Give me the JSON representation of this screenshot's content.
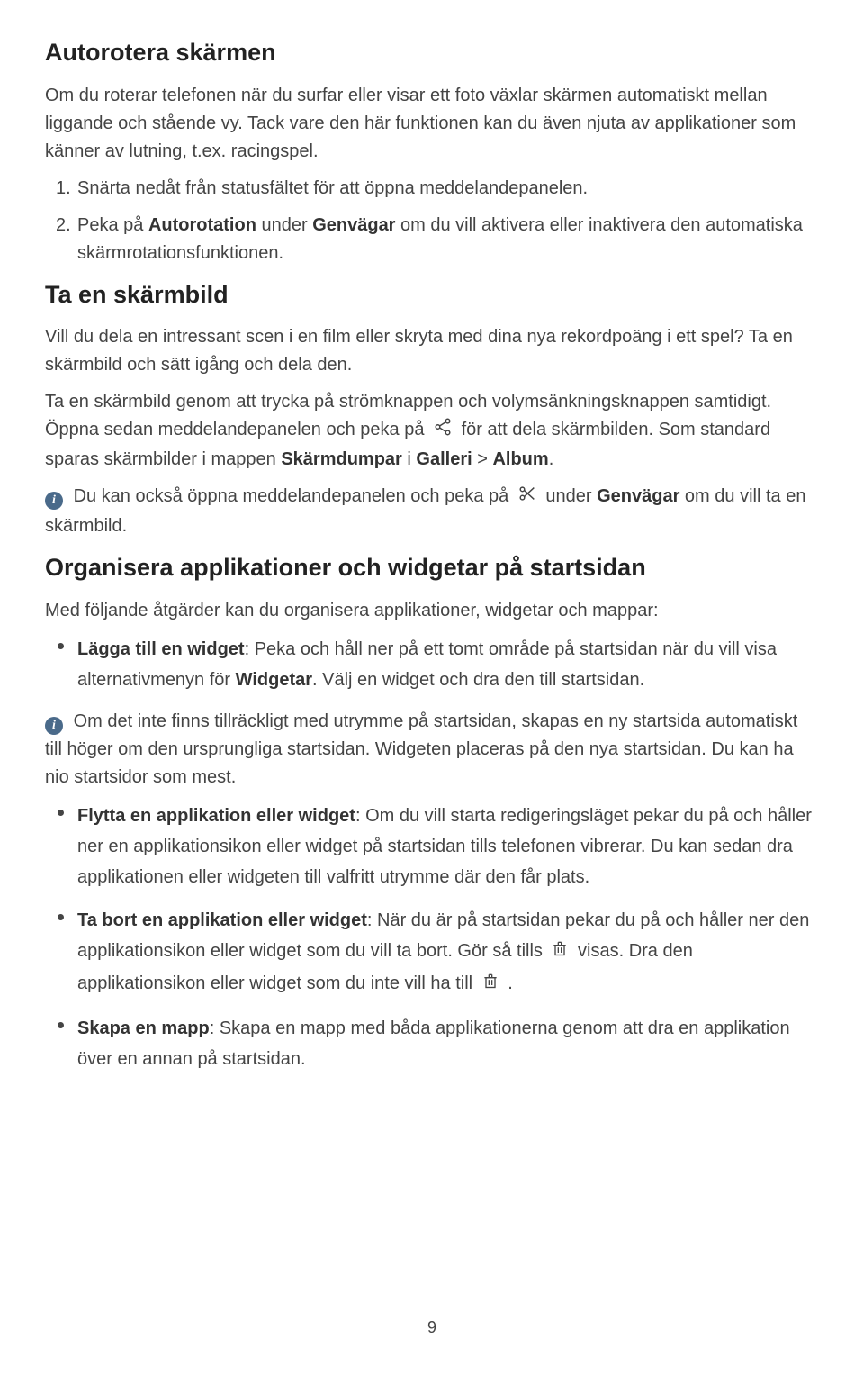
{
  "page_number": "9",
  "section1": {
    "heading": "Autorotera skärmen",
    "p1": "Om du roterar telefonen när du surfar eller visar ett foto växlar skärmen automatiskt mellan liggande och stående vy. Tack vare den här funktionen kan du även njuta av applikationer som känner av lutning, t.ex. racingspel.",
    "step1_num": "1.",
    "step1": "Snärta nedåt från statusfältet för att öppna meddelandepanelen.",
    "step2_num": "2.",
    "step2_a": "Peka på ",
    "step2_b": "Autorotation",
    "step2_c": " under ",
    "step2_d": "Genvägar",
    "step2_e": " om du vill aktivera eller inaktivera den automatiska skärmrotationsfunktionen."
  },
  "section2": {
    "heading": "Ta en skärmbild",
    "p1": "Vill du dela en intressant scen i en film eller skryta med dina nya rekordpoäng i ett spel? Ta en skärmbild och sätt igång och dela den.",
    "p2_a": "Ta en skärmbild genom att trycka på strömknappen och volymsänkningsknappen samtidigt. Öppna sedan meddelandepanelen och peka på ",
    "p2_b": " för att dela skärmbilden. Som standard sparas skärmbilder i mappen ",
    "p2_c": "Skärmdumpar",
    "p2_d": " i ",
    "p2_e": "Galleri",
    "p2_f": " > ",
    "p2_g": "Album",
    "p2_h": ".",
    "note_a": "Du kan också öppna meddelandepanelen och peka på ",
    "note_b": " under ",
    "note_c": "Genvägar",
    "note_d": " om du vill ta en skärmbild."
  },
  "section3": {
    "heading": "Organisera applikationer och widgetar på startsidan",
    "p1": "Med följande åtgärder kan du organisera applikationer, widgetar och mappar:",
    "b1_t": "Lägga till en widget",
    "b1_a": ": Peka och håll ner på ett tomt område på startsidan när du vill visa alternativmenyn för ",
    "b1_b": "Widgetar",
    "b1_c": ". Välj en widget och dra den till startsidan.",
    "note": "Om det inte finns tillräckligt med utrymme på startsidan, skapas en ny startsida automatiskt till höger om den ursprungliga startsidan. Widgeten placeras på den nya startsidan. Du kan ha nio startsidor som mest.",
    "b2_t": "Flytta en applikation eller widget",
    "b2_a": ": Om du vill starta redigeringsläget pekar du på och håller ner en applikationsikon eller widget på startsidan tills telefonen vibrerar. Du kan sedan dra applikationen eller widgeten till valfritt utrymme där den får plats.",
    "b3_t": "Ta bort en applikation eller widget",
    "b3_a": ": När du är på startsidan pekar du på och håller ner den applikationsikon eller widget som du vill ta bort. Gör så tills ",
    "b3_b": " visas. Dra den applikationsikon eller widget som du inte vill ha till ",
    "b3_c": " .",
    "b4_t": "Skapa en mapp",
    "b4_a": ": Skapa en mapp med båda applikationerna genom att dra en applikation över en annan på startsidan."
  }
}
